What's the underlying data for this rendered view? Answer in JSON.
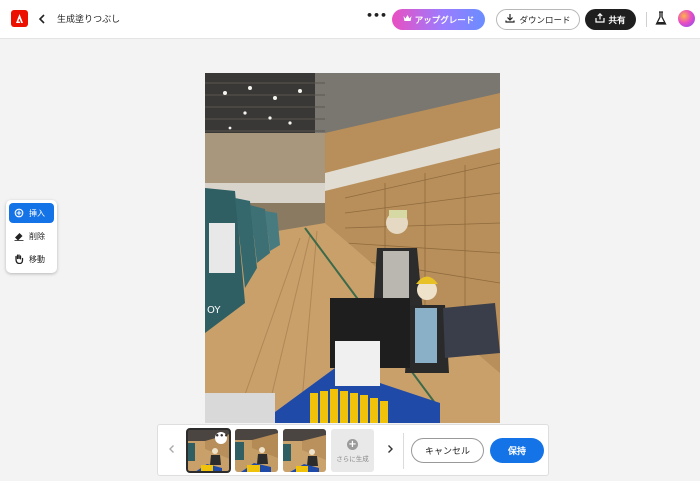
{
  "app": {
    "title": "生成塗りつぶし",
    "more_label": "•••",
    "upgrade_label": "アップグレード",
    "download_label": "ダウンロード",
    "share_label": "共有"
  },
  "tools": [
    {
      "label": "挿入",
      "icon": "insert-icon",
      "active": true
    },
    {
      "label": "削除",
      "icon": "eraser-icon",
      "active": false
    },
    {
      "label": "移動",
      "icon": "hand-icon",
      "active": false
    }
  ],
  "variations": {
    "more_label": "•••",
    "generate_label": "さらに生成"
  },
  "actions": {
    "cancel_label": "キャンセル",
    "keep_label": "保持"
  },
  "colors": {
    "accent": "#1473e6",
    "logo": "#eb1000",
    "share_bg": "#1f1f1f"
  }
}
